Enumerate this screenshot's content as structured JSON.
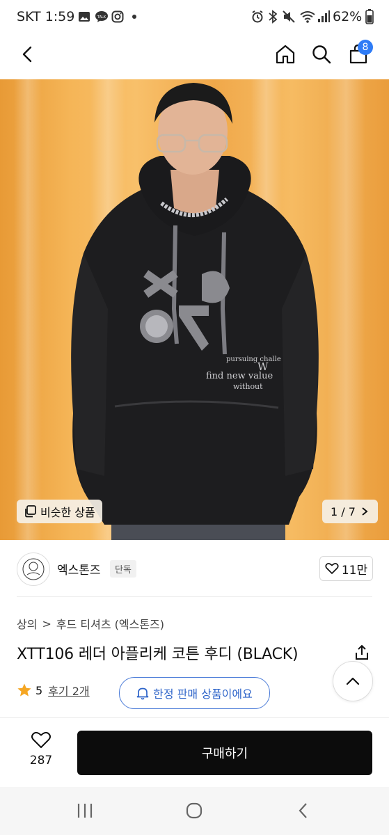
{
  "status_bar": {
    "time": "SKT 1:59",
    "battery": "62%",
    "notification_icons": [
      "image-icon",
      "talk-icon",
      "instagram-icon",
      "dot-icon"
    ],
    "system_icons": [
      "alarm-icon",
      "bluetooth-icon",
      "mute-icon",
      "wifi-icon",
      "signal-icon",
      "battery-icon"
    ]
  },
  "nav": {
    "cart_count": "8"
  },
  "hero": {
    "similar_label": "비슷한 상품",
    "page_indicator": "1 / 7",
    "print_text": [
      "pursuing challe",
      "find new value",
      "without",
      "W"
    ]
  },
  "store": {
    "name": "엑스톤즈",
    "badge": "단독",
    "likes": "11만"
  },
  "breadcrumb": {
    "level1": "상의",
    "separator": ">",
    "level2": "후드 티셔츠 (엑스톤즈)"
  },
  "product": {
    "title": "XTT106 레더 아플리케 코튼 후디 (BLACK)",
    "rating": "5",
    "reviews": "후기 2개",
    "limited_label": "한정 판매 상품이에요"
  },
  "bottom": {
    "wishlist_count": "287",
    "buy_label": "구매하기"
  },
  "colors": {
    "accent_blue": "#2c63c9",
    "star": "#f5a623",
    "cart_badge": "#2f7cf6",
    "buy_button": "#0c0c0c"
  }
}
